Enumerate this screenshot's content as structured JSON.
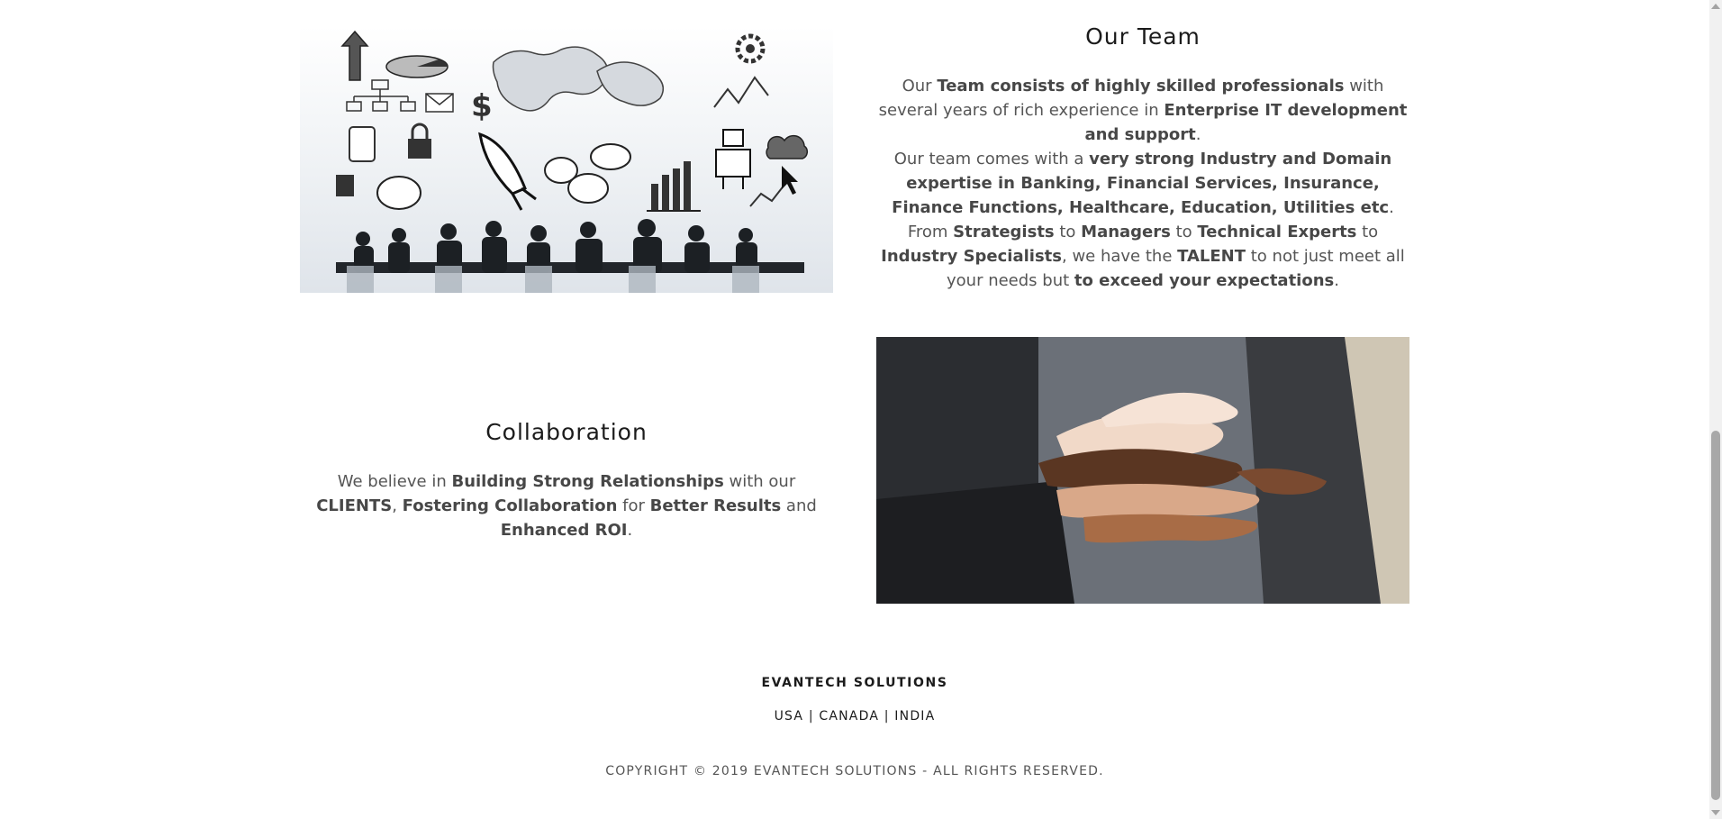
{
  "team": {
    "title": "Our Team",
    "p1": [
      {
        "t": "Our ",
        "b": false
      },
      {
        "t": "Team consists of highly skilled professionals",
        "b": true
      },
      {
        "t": " with several years of rich experience in ",
        "b": false
      },
      {
        "t": "Enterprise IT development and support",
        "b": true
      },
      {
        "t": ".",
        "b": false
      }
    ],
    "p2": [
      {
        "t": "Our team comes with a ",
        "b": false
      },
      {
        "t": "very strong Industry and Domain expertise in Banking, Financial Services, Insurance, Finance Functions, Healthcare, Education, Utilities etc",
        "b": true
      },
      {
        "t": ".",
        "b": false
      },
      {
        "t": "\n",
        "b": false
      },
      {
        "t": "From ",
        "b": false
      },
      {
        "t": "Strategists",
        "b": true
      },
      {
        "t": " to ",
        "b": false
      },
      {
        "t": "Managers",
        "b": true
      },
      {
        "t": " to ",
        "b": false
      },
      {
        "t": "Technical Experts",
        "b": true
      },
      {
        "t": " to ",
        "b": false
      },
      {
        "t": "Industry Specialists",
        "b": true
      },
      {
        "t": ", we have the ",
        "b": false
      },
      {
        "t": "TALENT",
        "b": true
      },
      {
        "t": " to not just meet all your needs but ",
        "b": false
      },
      {
        "t": "to exceed your expectations",
        "b": true
      },
      {
        "t": ".",
        "b": false
      }
    ]
  },
  "collaboration": {
    "title": "Collaboration",
    "p1": [
      {
        "t": "We believe in ",
        "b": false
      },
      {
        "t": "Building Strong Relationships",
        "b": true
      },
      {
        "t": " with our ",
        "b": false
      },
      {
        "t": "CLIENTS",
        "b": true
      },
      {
        "t": ", ",
        "b": false
      },
      {
        "t": "Fostering Collaboration",
        "b": true
      },
      {
        "t": " for ",
        "b": false
      },
      {
        "t": "Better Results",
        "b": true
      },
      {
        "t": " and ",
        "b": false
      },
      {
        "t": "Enhanced ROI",
        "b": true
      },
      {
        "t": ".",
        "b": false
      }
    ]
  },
  "footer": {
    "brand": "EVANTECH SOLUTIONS",
    "locations": "USA | CANADA | INDIA",
    "copyright": "COPYRIGHT © 2019 EVANTECH SOLUTIONS - ALL RIGHTS RESERVED."
  },
  "colors": {
    "heading": "#1b1b1b",
    "body_text": "#555555",
    "background": "#ffffff"
  }
}
